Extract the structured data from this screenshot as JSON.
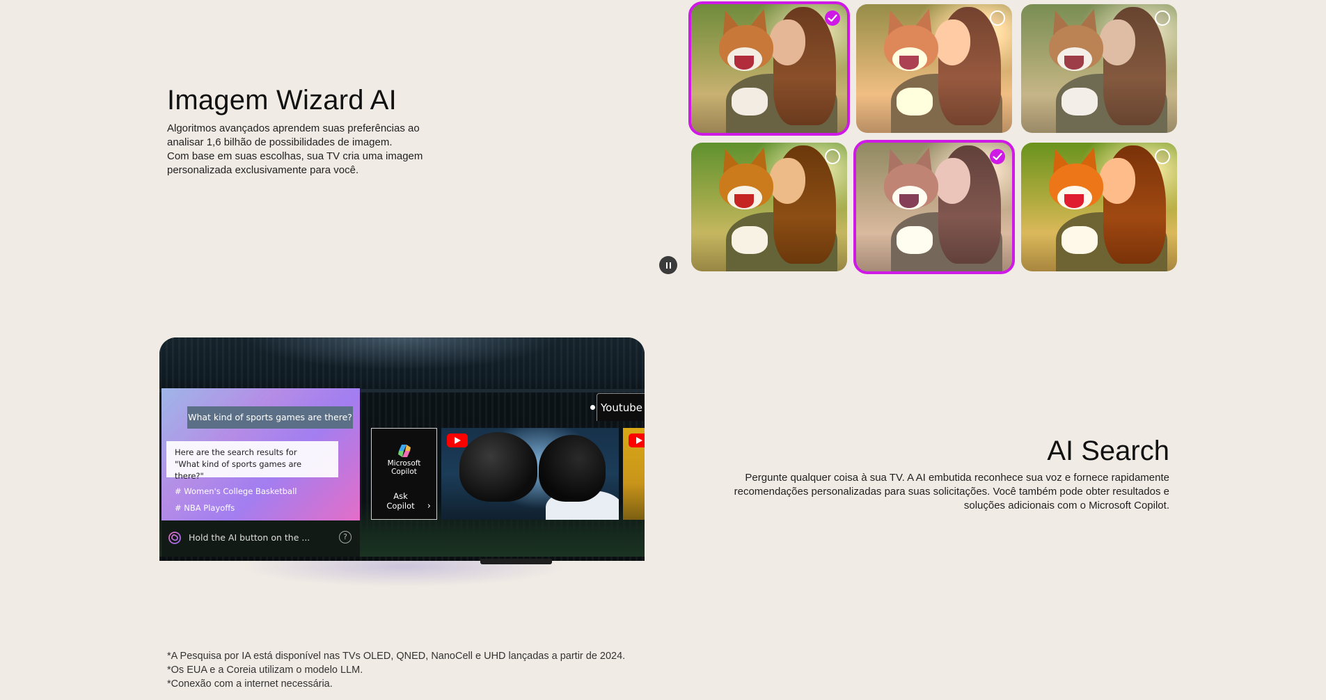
{
  "wizard": {
    "title": "Imagem Wizard AI",
    "description_lines": [
      "Algoritmos avançados aprendem suas preferências ao",
      "analisar 1,6 bilhão de possibilidades de imagem.",
      "Com base em suas escolhas, sua TV cria uma imagem",
      "personalizada exclusivamente para você."
    ],
    "accent_color": "#cf19e6",
    "tiles": [
      {
        "selected": true
      },
      {
        "selected": false
      },
      {
        "selected": false
      },
      {
        "selected": false
      },
      {
        "selected": true
      },
      {
        "selected": false
      }
    ],
    "pause_icon": "pause-icon"
  },
  "ai_search": {
    "title": "AI Search",
    "description_lines": [
      "Pergunte qualquer coisa à sua TV. A AI embutida reconhece sua voz e fornece rapidamente",
      "recomendações personalizadas para suas solicitações. Você também pode obter resultados e",
      "soluções adicionais com o Microsoft Copilot."
    ]
  },
  "tv_screen": {
    "question": "What kind of sports games are there?",
    "answer_line1": "Here are the search results for",
    "answer_line2": "\"What kind of sports games are there?\"",
    "tags": [
      "# Women's College Basketball",
      "# NBA Playoffs"
    ],
    "hint": "Hold the AI button on the ...",
    "help_symbol": "?",
    "source_tab": "Youtube",
    "copilot_name_line1": "Microsoft",
    "copilot_name_line2": "Copilot",
    "copilot_action_line1": "Ask",
    "copilot_action_line2": "Copilot",
    "youtube_brand_color": "#ff0000"
  },
  "footnotes": [
    "*A Pesquisa por IA está disponível nas TVs OLED, QNED, NanoCell e UHD lançadas a partir de 2024.",
    "*Os EUA e a Coreia utilizam o modelo LLM.",
    "*Conexão com a internet necessária."
  ]
}
